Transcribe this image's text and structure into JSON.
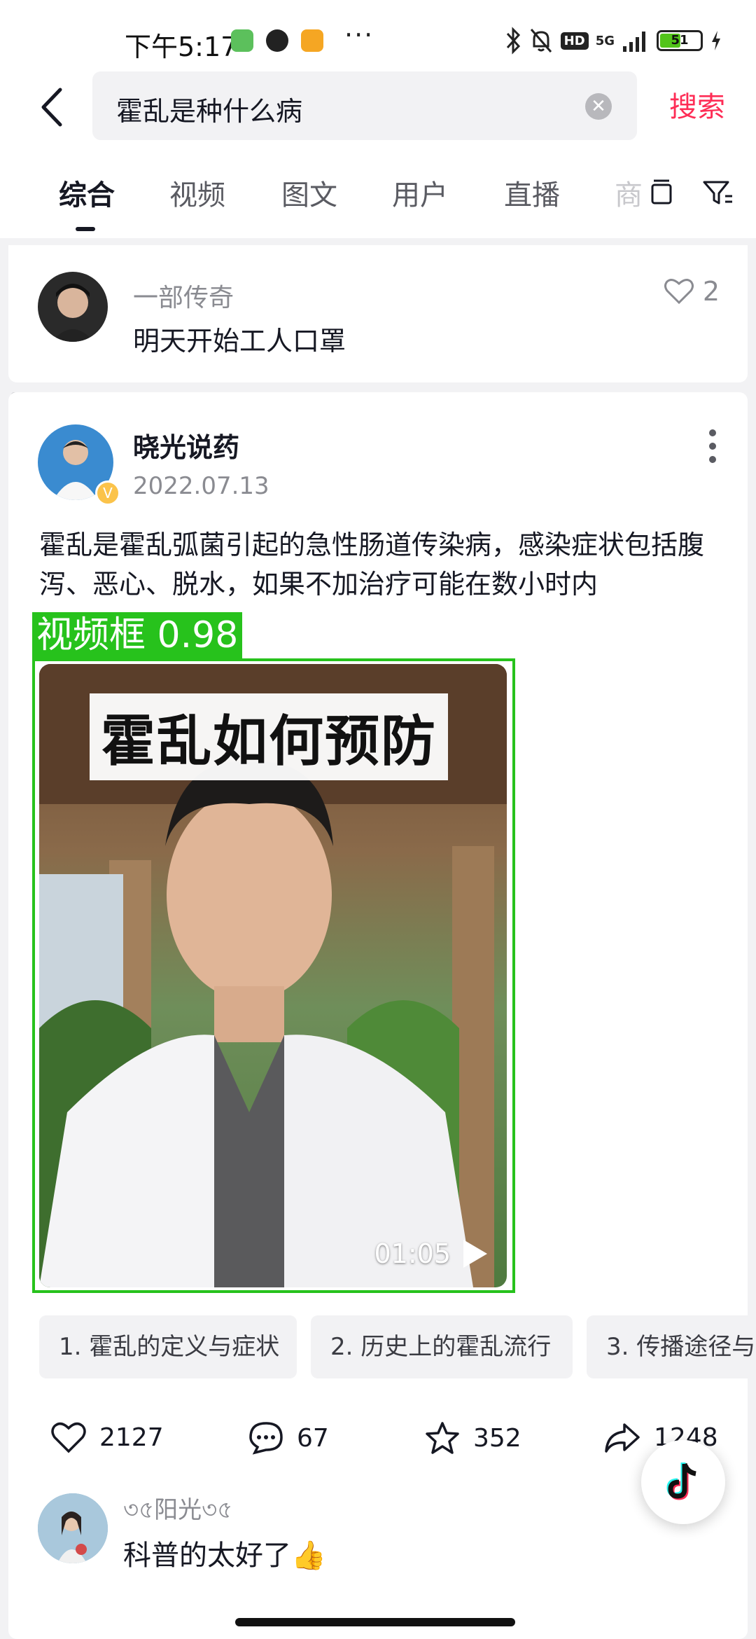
{
  "status_bar": {
    "time": "下午5:17",
    "dots": "···",
    "hd": "HD",
    "network": "5G",
    "battery": "51"
  },
  "search": {
    "query": "霍乱是种什么病",
    "search_button": "搜索"
  },
  "tabs": [
    {
      "label": "综合",
      "active": true
    },
    {
      "label": "视频"
    },
    {
      "label": "图文"
    },
    {
      "label": "用户"
    },
    {
      "label": "直播"
    },
    {
      "label": "商"
    }
  ],
  "comment_top": {
    "user": "一部传奇",
    "text": "明天开始工人口罩",
    "likes": "2"
  },
  "post": {
    "author": "晓光说药",
    "date": "2022.07.13",
    "body": "霍乱是霍乱弧菌引起的急性肠道传染病，感染症状包括腹泻、恶心、脱水，如果不加治疗可能在数小时内",
    "detection_label": "视频框 0.98",
    "video": {
      "title": "霍乱如何预防",
      "duration": "01:05"
    },
    "chapters": [
      "1. 霍乱的定义与症状",
      "2. 历史上的霍乱流行",
      "3. 传播途径与"
    ],
    "stats": {
      "likes": "2127",
      "comments": "67",
      "favorites": "352",
      "shares": "1248"
    }
  },
  "comment_bottom": {
    "user": "৩৫阳光৩৫",
    "text": "科普的太好了👍"
  },
  "colors": {
    "accent": "#fe2c55",
    "detection": "#27c21c"
  }
}
